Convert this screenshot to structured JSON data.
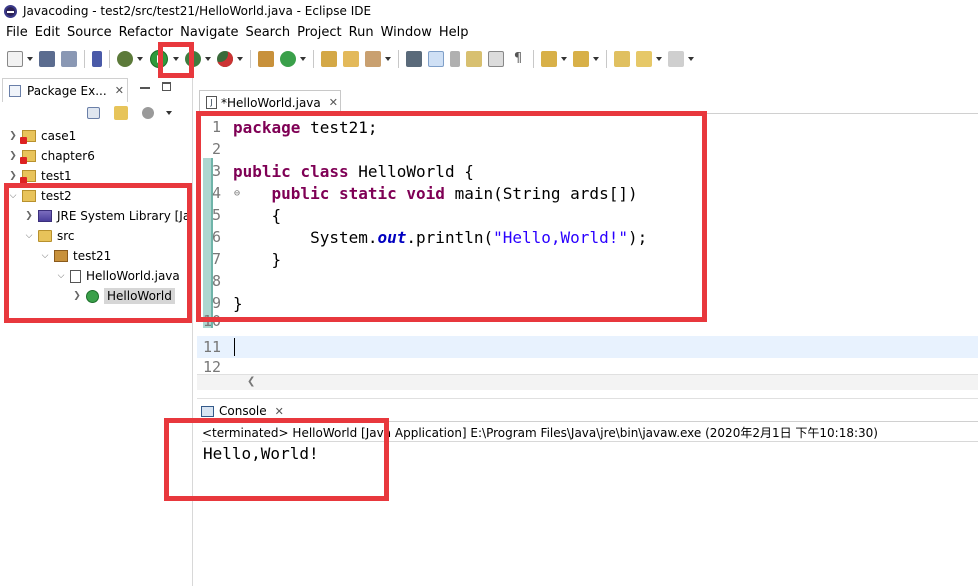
{
  "window": {
    "title": "Javacoding - test2/src/test21/HelloWorld.java - Eclipse IDE"
  },
  "menu": [
    "File",
    "Edit",
    "Source",
    "Refactor",
    "Navigate",
    "Search",
    "Project",
    "Run",
    "Window",
    "Help"
  ],
  "toolbar": {
    "icons": [
      "new-icon",
      "save-icon",
      "save-all-icon",
      "pin-icon",
      "debug-icon",
      "run-icon",
      "coverage-icon",
      "external-tools-icon",
      "new-java-project-icon",
      "new-class-icon",
      "open-type-icon",
      "open-task-icon",
      "search-icon",
      "toggle-mark-icon",
      "annotation-icon",
      "show-whitespace-icon",
      "next-annotation-icon",
      "previous-annotation-icon",
      "last-edit-icon",
      "back-icon",
      "forward-icon"
    ]
  },
  "package_explorer": {
    "tab_label": "Package Ex...",
    "tree": [
      {
        "label": "case1",
        "level": 0,
        "expanded": false,
        "icon": "project-error-icon"
      },
      {
        "label": "chapter6",
        "level": 0,
        "expanded": false,
        "icon": "project-error-icon"
      },
      {
        "label": "test1",
        "level": 0,
        "expanded": false,
        "icon": "project-error-icon"
      },
      {
        "label": "test2",
        "level": 0,
        "expanded": true,
        "icon": "project-icon"
      },
      {
        "label": "JRE System Library [Ja",
        "level": 1,
        "expanded": false,
        "icon": "library-icon"
      },
      {
        "label": "src",
        "level": 1,
        "expanded": true,
        "icon": "source-folder-icon"
      },
      {
        "label": "test21",
        "level": 2,
        "expanded": true,
        "icon": "package-icon"
      },
      {
        "label": "HelloWorld.java",
        "level": 3,
        "expanded": true,
        "icon": "java-file-icon"
      },
      {
        "label": "HelloWorld",
        "level": 4,
        "expanded": false,
        "icon": "class-icon",
        "selected": true
      }
    ]
  },
  "editor": {
    "tab_label": "*HelloWorld.java",
    "line_numbers": [
      "1",
      "2",
      "3",
      "4",
      "5",
      "6",
      "7",
      "8",
      "9",
      "10",
      "11",
      "12"
    ],
    "code": {
      "l1_kw": "package",
      "l1_rest": " test21;",
      "l3_kw1": "public",
      "l3_kw2": "class",
      "l3_rest": " HelloWorld {",
      "l4_kw1": "public",
      "l4_kw2": "static",
      "l4_kw3": "void",
      "l4_rest": " main(String ards[])",
      "l5": "    {",
      "l6_pre": "        System.",
      "l6_field": "out",
      "l6_mid": ".println(",
      "l6_str": "\"Hello,World!\"",
      "l6_post": ");",
      "l7": "    }",
      "l9": "}"
    },
    "current_line": 11
  },
  "console": {
    "tab_label": "Console",
    "status": "<terminated> HelloWorld [Java Application] E:\\Program Files\\Java\\jre\\bin\\javaw.exe (2020年2月1日 下午10:18:30)",
    "output": "Hello,World!"
  },
  "colors": {
    "highlight": "#e8383d",
    "keyword": "#7f0055",
    "string": "#2a00ff",
    "field": "#0000c0"
  }
}
